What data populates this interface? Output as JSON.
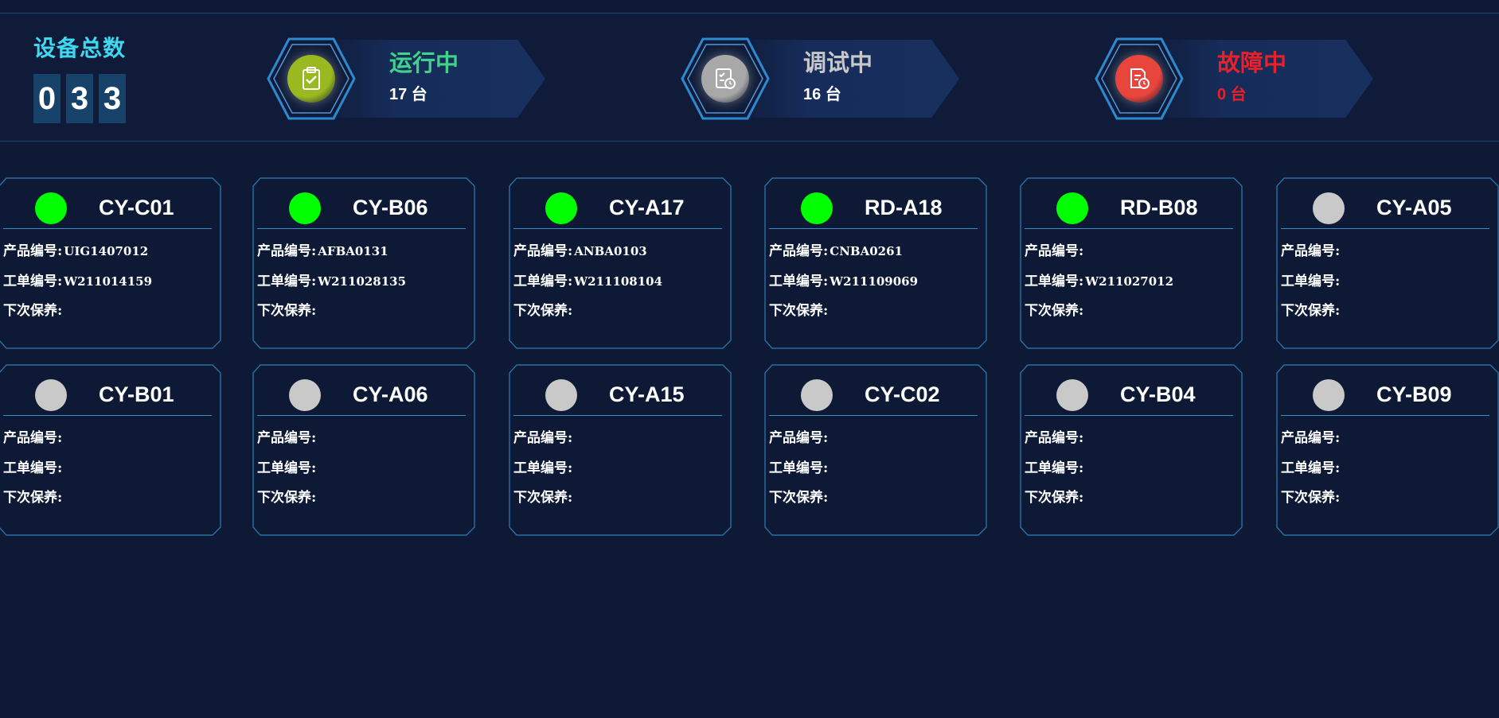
{
  "summary": {
    "total_label": "设备总数",
    "digits": [
      "0",
      "3",
      "3"
    ]
  },
  "statuses": [
    {
      "label": "运行中",
      "count": "17 台",
      "color": "#41d38a",
      "icon": "clipboard-check-icon",
      "circle": "#9ab820"
    },
    {
      "label": "调试中",
      "count": "16 台",
      "color": "#c8c8c8",
      "icon": "checklist-clock-icon",
      "circle": "#a8a8a8"
    },
    {
      "label": "故障中",
      "count": "0 台",
      "color": "#e8202a",
      "icon": "document-clock-icon",
      "circle": "#e8453c"
    }
  ],
  "field_labels": {
    "product": "产品编号:",
    "order": "工单编号:",
    "maintenance": "下次保养:"
  },
  "devices": [
    {
      "name": "CY-C01",
      "status": "running",
      "product": "UIG1407012",
      "order": "W211014159",
      "maintenance": ""
    },
    {
      "name": "CY-B06",
      "status": "running",
      "product": "AFBA0131",
      "order": "W211028135",
      "maintenance": ""
    },
    {
      "name": "CY-A17",
      "status": "running",
      "product": "ANBA0103",
      "order": "W211108104",
      "maintenance": ""
    },
    {
      "name": "RD-A18",
      "status": "running",
      "product": "CNBA0261",
      "order": "W211109069",
      "maintenance": ""
    },
    {
      "name": "RD-B08",
      "status": "running",
      "product": "",
      "order": "W211027012",
      "maintenance": ""
    },
    {
      "name": "CY-A05",
      "status": "idle",
      "product": "",
      "order": "",
      "maintenance": ""
    },
    {
      "name": "CY-B01",
      "status": "idle",
      "product": "",
      "order": "",
      "maintenance": ""
    },
    {
      "name": "CY-A06",
      "status": "idle",
      "product": "",
      "order": "",
      "maintenance": ""
    },
    {
      "name": "CY-A15",
      "status": "idle",
      "product": "",
      "order": "",
      "maintenance": ""
    },
    {
      "name": "CY-C02",
      "status": "idle",
      "product": "",
      "order": "",
      "maintenance": ""
    },
    {
      "name": "CY-B04",
      "status": "idle",
      "product": "",
      "order": "",
      "maintenance": ""
    },
    {
      "name": "CY-B09",
      "status": "idle",
      "product": "",
      "order": "",
      "maintenance": ""
    }
  ],
  "colors": {
    "running": "#00ff00",
    "idle": "#c9c9c9",
    "frame": "#2a7fb8"
  }
}
